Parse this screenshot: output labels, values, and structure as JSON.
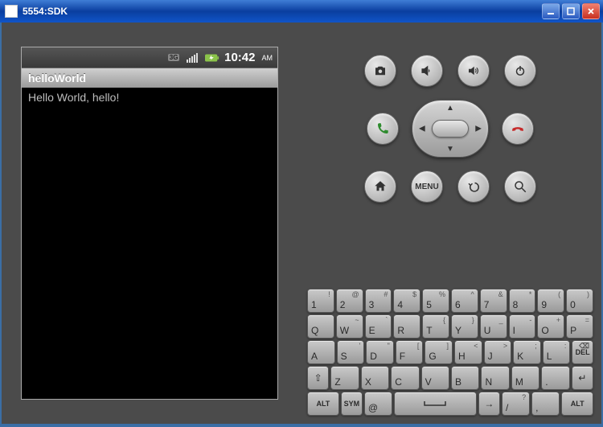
{
  "window": {
    "title": "5554:SDK"
  },
  "phone": {
    "status": {
      "network_label": "3G",
      "time": "10:42",
      "ampm": "AM"
    },
    "app_title": "helloWorld",
    "content_text": "Hello World, hello!"
  },
  "controls": {
    "row1": {
      "camera": "camera-icon",
      "volume_down": "volume-down-icon",
      "volume_up": "volume-up-icon",
      "power": "power-icon"
    },
    "row2": {
      "call": "call-icon",
      "end_call": "end-call-icon"
    },
    "row3": {
      "home": "home-icon",
      "menu_label": "MENU",
      "back": "back-icon",
      "search": "search-icon"
    }
  },
  "keyboard": {
    "rows": [
      [
        {
          "main": "1",
          "sub": "!"
        },
        {
          "main": "2",
          "sub": "@"
        },
        {
          "main": "3",
          "sub": "#"
        },
        {
          "main": "4",
          "sub": "$"
        },
        {
          "main": "5",
          "sub": "%"
        },
        {
          "main": "6",
          "sub": "^"
        },
        {
          "main": "7",
          "sub": "&"
        },
        {
          "main": "8",
          "sub": "*"
        },
        {
          "main": "9",
          "sub": "("
        },
        {
          "main": "0",
          "sub": ")"
        }
      ],
      [
        {
          "main": "Q",
          "sub": ""
        },
        {
          "main": "W",
          "sub": "~"
        },
        {
          "main": "E",
          "sub": "`"
        },
        {
          "main": "R",
          "sub": ""
        },
        {
          "main": "T",
          "sub": "{"
        },
        {
          "main": "Y",
          "sub": "}"
        },
        {
          "main": "U",
          "sub": "_"
        },
        {
          "main": "I",
          "sub": "-"
        },
        {
          "main": "O",
          "sub": "+"
        },
        {
          "main": "P",
          "sub": "="
        }
      ],
      [
        {
          "main": "A",
          "sub": ""
        },
        {
          "main": "S",
          "sub": "'"
        },
        {
          "main": "D",
          "sub": "\""
        },
        {
          "main": "F",
          "sub": "["
        },
        {
          "main": "G",
          "sub": "]"
        },
        {
          "main": "H",
          "sub": "<"
        },
        {
          "main": "J",
          "sub": ">"
        },
        {
          "main": "K",
          "sub": ";"
        },
        {
          "main": "L",
          "sub": ":"
        },
        {
          "main": "DEL",
          "sub": "",
          "special": "del"
        }
      ],
      [
        {
          "main": "⇧",
          "sub": "",
          "special": "shift"
        },
        {
          "main": "Z",
          "sub": ""
        },
        {
          "main": "X",
          "sub": ""
        },
        {
          "main": "C",
          "sub": ""
        },
        {
          "main": "V",
          "sub": ""
        },
        {
          "main": "B",
          "sub": ""
        },
        {
          "main": "N",
          "sub": ""
        },
        {
          "main": "M",
          "sub": ""
        },
        {
          "main": ".",
          "sub": ""
        },
        {
          "main": "↵",
          "sub": "",
          "special": "enter"
        }
      ],
      [
        {
          "main": "ALT",
          "sub": "",
          "special": "alt",
          "w": "wide15"
        },
        {
          "main": "SYM",
          "sub": "",
          "special": "sym"
        },
        {
          "main": "@",
          "sub": ""
        },
        {
          "main": "␣",
          "sub": "",
          "special": "space",
          "w": "wide4"
        },
        {
          "main": "→",
          "sub": "",
          "special": "lang"
        },
        {
          "main": "/",
          "sub": "?"
        },
        {
          "main": ",",
          "sub": ""
        },
        {
          "main": "ALT",
          "sub": "",
          "special": "alt",
          "w": "wide15"
        }
      ]
    ]
  }
}
